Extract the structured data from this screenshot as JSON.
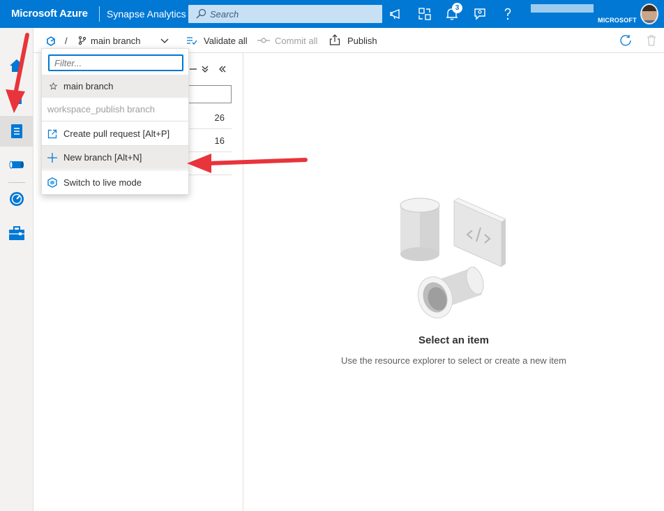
{
  "header": {
    "brand": "Microsoft Azure",
    "product": "Synapse Analytics",
    "search_placeholder": "Search",
    "notification_count": "3",
    "account_label": "MICROSOFT"
  },
  "toolbar": {
    "separator": "/",
    "branch_label": "main branch",
    "validate_all": "Validate all",
    "commit_all": "Commit all",
    "publish": "Publish"
  },
  "explorer": {
    "rows": [
      {
        "count": "26"
      },
      {
        "count": "16"
      }
    ]
  },
  "branch_dropdown": {
    "filter_placeholder": "Filter...",
    "branches": [
      {
        "label": "main branch",
        "selected": true
      },
      {
        "label": "workspace_publish branch",
        "disabled": true
      }
    ],
    "actions": [
      {
        "label": "Create pull request [Alt+P]",
        "icon": "external-link-icon"
      },
      {
        "label": "New branch [Alt+N]",
        "icon": "plus-icon"
      },
      {
        "label": "Switch to live mode",
        "icon": "live-mode-icon"
      }
    ]
  },
  "empty_state": {
    "title": "Select an item",
    "subtitle": "Use the resource explorer to select or create a new item"
  },
  "colors": {
    "accent": "#0078d4",
    "annotation_arrow": "#e8343b"
  }
}
